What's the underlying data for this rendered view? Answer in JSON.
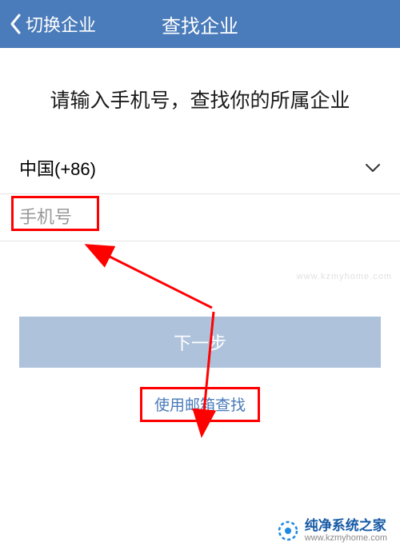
{
  "header": {
    "back_label": "切换企业",
    "title": "查找企业"
  },
  "instruction": "请输入手机号，查找你的所属企业",
  "country_selector": {
    "label": "中国(+86)"
  },
  "phone_input": {
    "placeholder": "手机号",
    "value": ""
  },
  "next_button": {
    "label": "下一步"
  },
  "email_search": {
    "label": "使用邮箱查找"
  },
  "watermark": "www.kzmyhome.com",
  "footer": {
    "brand": "纯净系统之家",
    "url": "www.kzmyhome.com"
  },
  "annotations": {
    "highlight_color": "#ff0000"
  }
}
